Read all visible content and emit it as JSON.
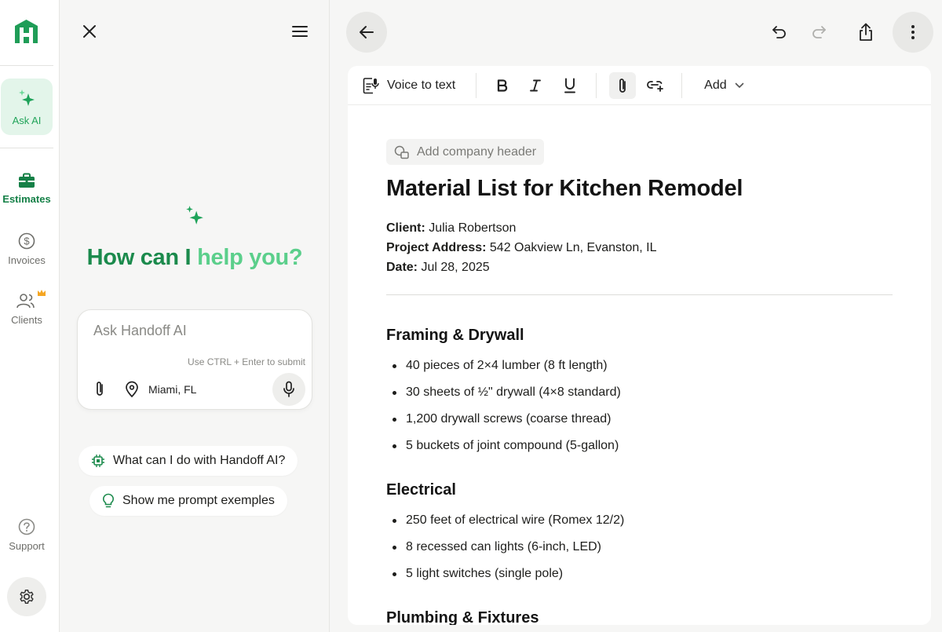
{
  "rail": {
    "ask_ai_label": "Ask AI",
    "items": [
      {
        "label": "Estimates"
      },
      {
        "label": "Invoices"
      },
      {
        "label": "Clients"
      }
    ],
    "support_label": "Support"
  },
  "ai_panel": {
    "heading_part1": "How can I ",
    "heading_part2": "help you?",
    "input_placeholder": "Ask Handoff AI",
    "hint": "Use CTRL + Enter to submit",
    "location": "Miami, FL",
    "suggestions": [
      {
        "label": "What can I do with Handoff AI?"
      },
      {
        "label": "Show me prompt exemples"
      }
    ]
  },
  "toolbar": {
    "voice_label": "Voice to text",
    "add_label": "Add"
  },
  "document": {
    "company_header_label": "Add company header",
    "title": "Material List for Kitchen Remodel",
    "meta": [
      {
        "key": "Client:",
        "value": " Julia Robertson"
      },
      {
        "key": "Project Address:",
        "value": " 542 Oakview Ln, Evanston, IL"
      },
      {
        "key": "Date:",
        "value": " Jul 28, 2025"
      }
    ],
    "sections": [
      {
        "title": "Framing & Drywall",
        "items": [
          "40 pieces of 2×4 lumber (8 ft length)",
          "30 sheets of ½\" drywall (4×8 standard)",
          "1,200 drywall screws (coarse thread)",
          "5 buckets of joint compound (5-gallon)"
        ]
      },
      {
        "title": "Electrical",
        "items": [
          "250 feet of electrical wire (Romex 12/2)",
          "8 recessed can lights (6-inch, LED)",
          "5 light switches (single pole)"
        ]
      },
      {
        "title": "Plumbing & Fixtures",
        "items": []
      }
    ]
  },
  "colors": {
    "brand_green": "#1b8a4c",
    "light_green": "#5bcf8b",
    "ask_ai_bg": "#e3f5ea",
    "premium_crown": "#f5a623"
  }
}
